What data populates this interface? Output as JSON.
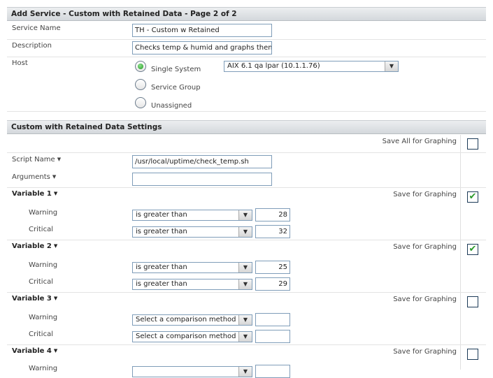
{
  "page": {
    "title": "Add Service - Custom with Retained Data - Page 2 of 2"
  },
  "service": {
    "name_label": "Service Name",
    "name_value": "TH - Custom w Retained",
    "description_label": "Description",
    "description_value": "Checks temp & humid and graphs them",
    "host_label": "Host",
    "host_options": {
      "single_system": "Single System",
      "service_group": "Service Group",
      "unassigned": "Unassigned"
    },
    "host_selected": "Single System",
    "system_select_value": "AIX 6.1 qa lpar (10.1.1.76)"
  },
  "settings": {
    "title": "Custom with Retained Data Settings",
    "save_all_label": "Save All for Graphing",
    "script_name_label": "Script Name",
    "script_name_value": "/usr/local/uptime/check_temp.sh",
    "arguments_label": "Arguments",
    "arguments_value": "",
    "save_for_graphing_label": "Save for Graphing",
    "warning_label": "Warning",
    "critical_label": "Critical",
    "variables": [
      {
        "label": "Variable 1",
        "save": true,
        "warning_method": "is greater than",
        "warning_value": "28",
        "critical_method": "is greater than",
        "critical_value": "32"
      },
      {
        "label": "Variable 2",
        "save": true,
        "warning_method": "is greater than",
        "warning_value": "25",
        "critical_method": "is greater than",
        "critical_value": "29"
      },
      {
        "label": "Variable 3",
        "save": false,
        "warning_method": "Select a comparison method",
        "warning_value": "",
        "critical_method": "Select a comparison method",
        "critical_value": ""
      },
      {
        "label": "Variable 4",
        "save": false,
        "warning_method": "",
        "warning_value": "",
        "critical_method": "",
        "critical_value": ""
      }
    ]
  },
  "icons": {
    "dropdown_caret": "caret-down-icon",
    "select_arrow": "chevron-down-icon",
    "checkmark": "checkmark-icon"
  }
}
